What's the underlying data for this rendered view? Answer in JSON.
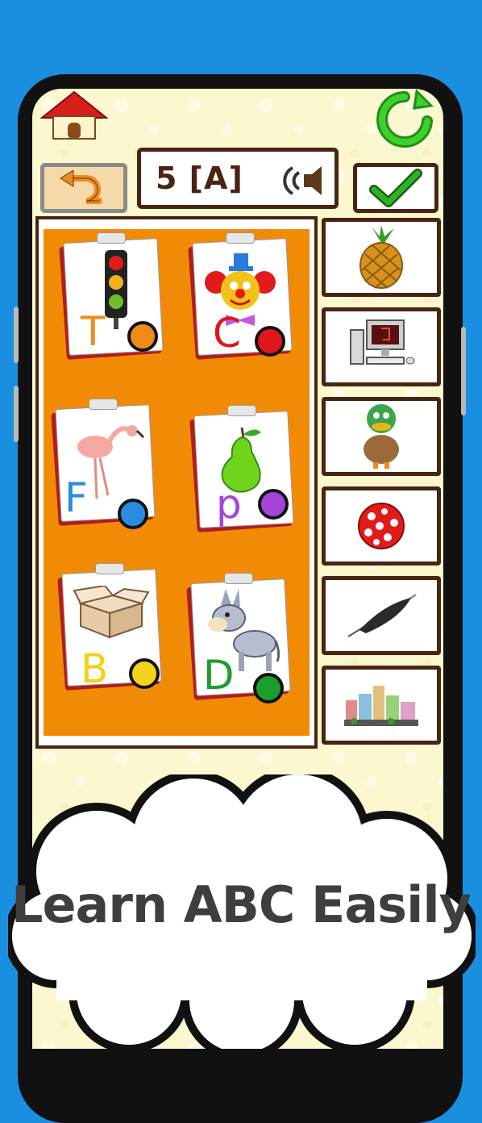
{
  "level": {
    "label": "5 [A]"
  },
  "cards": [
    {
      "letter": "T",
      "picture": "traffic-light",
      "letter_color": "#f08a1a",
      "dot_color": "#f08a1a"
    },
    {
      "letter": "C",
      "picture": "clown",
      "letter_color": "#e0161c",
      "dot_color": "#e0161c"
    },
    {
      "letter": "F",
      "picture": "flamingo",
      "letter_color": "#2a8be0",
      "dot_color": "#2a8be0"
    },
    {
      "letter": "p",
      "picture": "pear",
      "letter_color": "#a544d8",
      "dot_color": "#a544d8"
    },
    {
      "letter": "B",
      "picture": "box",
      "letter_color": "#f2d21a",
      "dot_color": "#f2d21a"
    },
    {
      "letter": "D",
      "picture": "donkey",
      "letter_color": "#1a9e2c",
      "dot_color": "#1a9e2c"
    }
  ],
  "options": [
    {
      "picture": "pineapple"
    },
    {
      "picture": "computer"
    },
    {
      "picture": "duck"
    },
    {
      "picture": "ball"
    },
    {
      "picture": "feather"
    },
    {
      "picture": "city"
    }
  ],
  "icons": {
    "home": "home-icon",
    "refresh": "refresh-icon",
    "back": "back-arrow-icon",
    "sound": "speaker-icon",
    "check": "check-icon"
  },
  "colors": {
    "background": "#1a8fe0",
    "board": "#f18b06",
    "frame": "#4a2412"
  },
  "banner": {
    "text": "Learn ABC Easily"
  }
}
